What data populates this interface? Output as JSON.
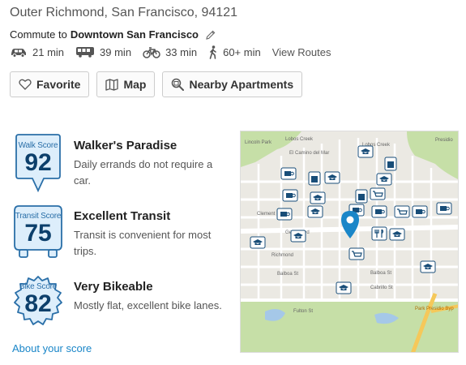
{
  "location": "Outer Richmond, San Francisco, 94121",
  "commute": {
    "prefix": "Commute to",
    "destination": "Downtown San Francisco"
  },
  "modes": [
    {
      "icon": "car-icon",
      "time": "21 min"
    },
    {
      "icon": "bus-icon",
      "time": "39 min"
    },
    {
      "icon": "bike-icon",
      "time": "33 min"
    },
    {
      "icon": "walk-icon",
      "time": "60+ min"
    }
  ],
  "view_routes": "View Routes",
  "buttons": {
    "favorite": "Favorite",
    "map": "Map",
    "nearby": "Nearby Apartments"
  },
  "scores": [
    {
      "label": "Walk Score",
      "value": "92",
      "title": "Walker's Paradise",
      "description": "Daily errands do not require a car."
    },
    {
      "label": "Transit Score",
      "value": "75",
      "title": "Excellent Transit",
      "description": "Transit is convenient for most trips."
    },
    {
      "label": "Bike Score",
      "value": "82",
      "title": "Very Bikeable",
      "description": "Mostly flat, excellent bike lanes."
    }
  ],
  "about_link": "About your score",
  "map": {
    "streets": [
      "Clement St",
      "Geary Blvd",
      "Balboa St",
      "Cabrillo St",
      "Fulton St",
      "Lincoln Park",
      "Lobos Creek",
      "El Camino del Mar",
      "Richmond",
      "Park Presidio Byp",
      "Presidio"
    ],
    "colors": {
      "park": "#c6dfa7",
      "road": "#ffffff",
      "water": "#a5c8e8",
      "pin": "#1a86c8",
      "icon": "#184d78",
      "highway": "#f5c85a"
    }
  }
}
